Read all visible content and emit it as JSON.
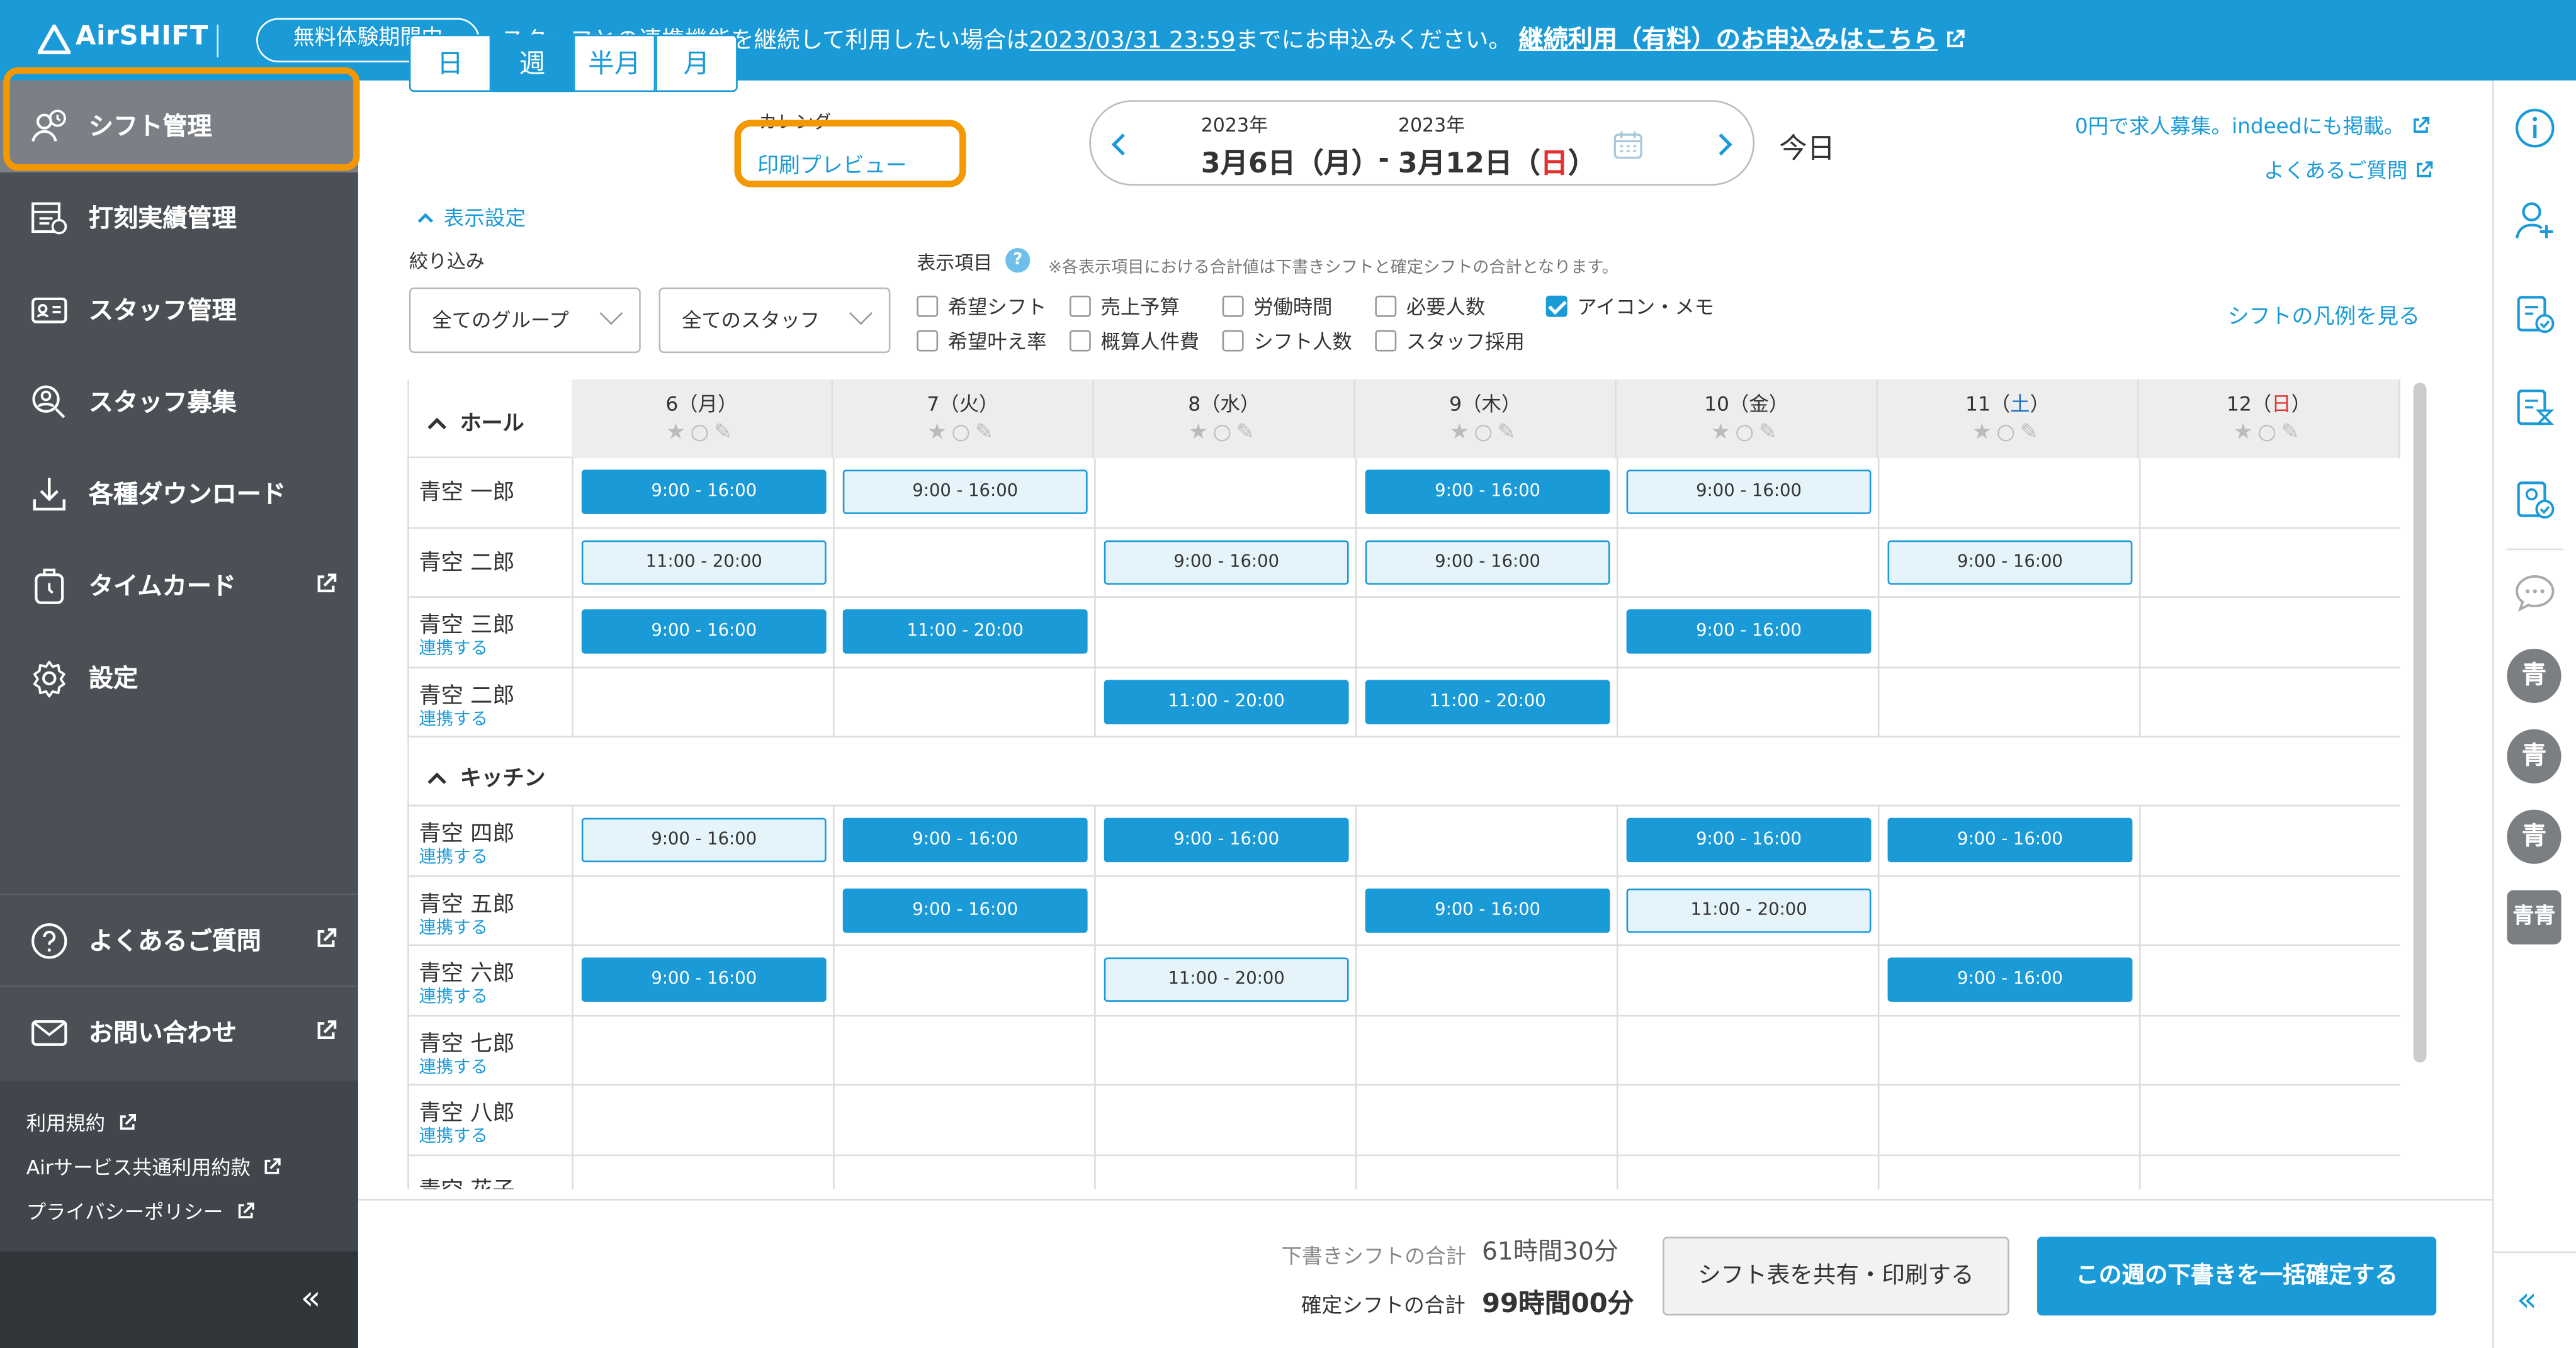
{
  "header": {
    "brand": "AirSHIFT",
    "trial_badge": "無料体験期間中",
    "notice_prefix": "スタッフとの連携機能を継続して利用したい場合は",
    "notice_deadline": "2023/03/31 23:59",
    "notice_mid": "までにお申込みください。",
    "notice_link": "継続利用（有料）のお申込みはこちら"
  },
  "sidebar": {
    "items": [
      {
        "label": "シフト管理",
        "icon": "shift-icon"
      },
      {
        "label": "打刻実績管理",
        "icon": "timeclock-record-icon"
      },
      {
        "label": "スタッフ管理",
        "icon": "staff-card-icon"
      },
      {
        "label": "スタッフ募集",
        "icon": "recruit-search-icon"
      },
      {
        "label": "各種ダウンロード",
        "icon": "download-icon"
      },
      {
        "label": "タイムカード",
        "icon": "timecard-icon"
      },
      {
        "label": "設定",
        "icon": "gear-icon"
      }
    ],
    "help_items": [
      {
        "label": "よくあるご質問",
        "icon": "question-icon"
      },
      {
        "label": "お問い合わせ",
        "icon": "mail-icon"
      }
    ],
    "legal_links": [
      "利用規約",
      "Airサービス共通利用約款",
      "プライバシーポリシー"
    ],
    "collapse": "«"
  },
  "view_tabs": [
    "日",
    "週",
    "半月",
    "月"
  ],
  "active_view": "週",
  "print": {
    "label": "カレンダー",
    "link": "印刷プレビュー"
  },
  "date_range": {
    "start_year": "2023年",
    "start": "3月6日（月）",
    "sep": "-",
    "end_year": "2023年",
    "end_prefix": "3月12日（",
    "end_day": "日",
    "end_suffix": "）"
  },
  "today_button": "今日",
  "top_links": [
    "0円で求人募集。indeedにも掲載。",
    "よくあるご質問"
  ],
  "display_settings": {
    "toggle": "表示設定",
    "filter_label": "絞り込み",
    "group_select": "全てのグループ",
    "staff_select": "全てのスタッフ",
    "items_label": "表示項目",
    "items_note": "※各表示項目における合計値は下書きシフトと確定シフトの合計となります。",
    "checkboxes": [
      {
        "label": "希望シフト",
        "checked": false
      },
      {
        "label": "売上予算",
        "checked": false
      },
      {
        "label": "労働時間",
        "checked": false
      },
      {
        "label": "必要人数",
        "checked": false
      },
      {
        "label": "アイコン・メモ",
        "checked": true
      },
      {
        "label": "希望叶え率",
        "checked": false
      },
      {
        "label": "概算人件費",
        "checked": false
      },
      {
        "label": "シフト人数",
        "checked": false
      },
      {
        "label": "スタッフ採用",
        "checked": false
      }
    ],
    "legend_link": "シフトの凡例を見る"
  },
  "days": [
    {
      "num": "6",
      "dow": "月",
      "color": "#333333"
    },
    {
      "num": "7",
      "dow": "火",
      "color": "#333333"
    },
    {
      "num": "8",
      "dow": "水",
      "color": "#333333"
    },
    {
      "num": "9",
      "dow": "木",
      "color": "#333333"
    },
    {
      "num": "10",
      "dow": "金",
      "color": "#333333"
    },
    {
      "num": "11",
      "dow": "土",
      "color": "#1a6fc4"
    },
    {
      "num": "12",
      "dow": "日",
      "color": "#e0312f"
    }
  ],
  "groups": [
    {
      "name": "ホール",
      "staff": [
        {
          "name": "青空 一郎",
          "link": "",
          "shifts": [
            [
              "9:00 - 16:00",
              "c"
            ],
            [
              "9:00 - 16:00",
              "d"
            ],
            null,
            [
              "9:00 - 16:00",
              "c"
            ],
            [
              "9:00 - 16:00",
              "d"
            ],
            null,
            null
          ]
        },
        {
          "name": "青空 二郎",
          "link": "",
          "shifts": [
            [
              "11:00 - 20:00",
              "d"
            ],
            null,
            [
              "9:00 - 16:00",
              "d"
            ],
            [
              "9:00 - 16:00",
              "d"
            ],
            null,
            [
              "9:00 - 16:00",
              "d"
            ],
            null
          ]
        },
        {
          "name": "青空 三郎",
          "link": "連携する",
          "shifts": [
            [
              "9:00 - 16:00",
              "c"
            ],
            [
              "11:00 - 20:00",
              "c"
            ],
            null,
            null,
            [
              "9:00 - 16:00",
              "c"
            ],
            null,
            null
          ]
        },
        {
          "name": "青空 二郎",
          "link": "連携する",
          "shifts": [
            null,
            null,
            [
              "11:00 - 20:00",
              "c"
            ],
            [
              "11:00 - 20:00",
              "c"
            ],
            null,
            null,
            null
          ]
        }
      ]
    },
    {
      "name": "キッチン",
      "staff": [
        {
          "name": "青空 四郎",
          "link": "連携する",
          "shifts": [
            [
              "9:00 - 16:00",
              "d"
            ],
            [
              "9:00 - 16:00",
              "c"
            ],
            [
              "9:00 - 16:00",
              "c"
            ],
            null,
            [
              "9:00 - 16:00",
              "c"
            ],
            [
              "9:00 - 16:00",
              "c"
            ],
            null
          ]
        },
        {
          "name": "青空 五郎",
          "link": "連携する",
          "shifts": [
            null,
            [
              "9:00 - 16:00",
              "c"
            ],
            null,
            [
              "9:00 - 16:00",
              "c"
            ],
            [
              "11:00 - 20:00",
              "d"
            ],
            null,
            null
          ]
        },
        {
          "name": "青空 六郎",
          "link": "連携する",
          "shifts": [
            [
              "9:00 - 16:00",
              "c"
            ],
            null,
            [
              "11:00 - 20:00",
              "d"
            ],
            null,
            null,
            [
              "9:00 - 16:00",
              "c"
            ],
            null
          ]
        },
        {
          "name": "青空 七郎",
          "link": "連携する",
          "shifts": [
            null,
            null,
            null,
            null,
            null,
            null,
            null
          ]
        },
        {
          "name": "青空 八郎",
          "link": "連携する",
          "shifts": [
            null,
            null,
            null,
            null,
            null,
            null,
            null
          ]
        },
        {
          "name": "青空 花子",
          "link": "",
          "shifts": [
            null,
            null,
            null,
            null,
            null,
            null,
            null
          ]
        }
      ]
    }
  ],
  "right_rail": {
    "icons": [
      "info-icon",
      "add-user-icon",
      "shift-check-icon",
      "hourglass-doc-icon",
      "approve-doc-icon",
      "chat-icon"
    ],
    "avatars": [
      "青",
      "青",
      "青",
      "青青"
    ],
    "collapse": "«"
  },
  "footer": {
    "draft_label": "下書きシフトの合計",
    "draft_value": "61時間30分",
    "confirmed_label": "確定シフトの合計",
    "confirmed_value": "99時間00分",
    "share_button": "シフト表を共有・印刷する",
    "confirm_button": "この週の下書きを一括確定する"
  },
  "colors": {
    "accent": "#1a9ad7",
    "highlight": "#f39800",
    "sidebar": "#4a5055"
  }
}
